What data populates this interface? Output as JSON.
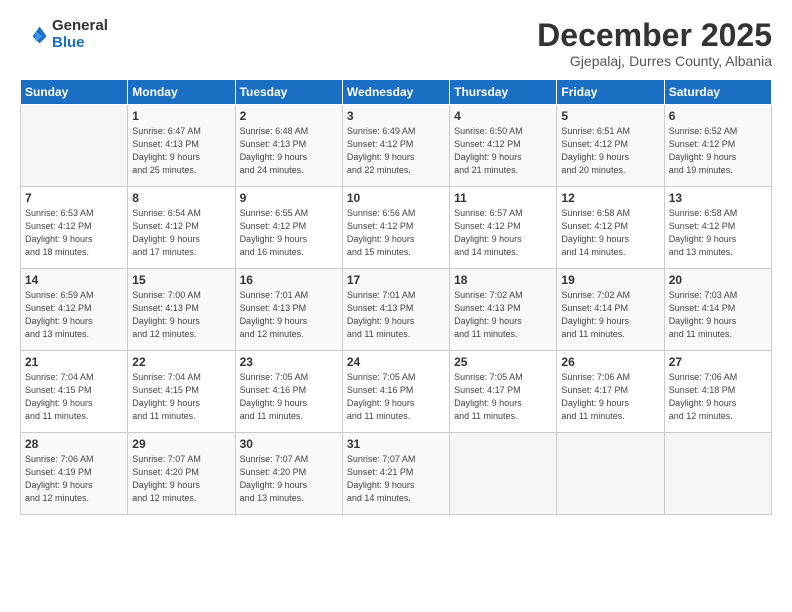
{
  "logo": {
    "general": "General",
    "blue": "Blue"
  },
  "header": {
    "month": "December 2025",
    "location": "Gjepalaj, Durres County, Albania"
  },
  "days_of_week": [
    "Sunday",
    "Monday",
    "Tuesday",
    "Wednesday",
    "Thursday",
    "Friday",
    "Saturday"
  ],
  "weeks": [
    [
      {
        "day": "",
        "info": ""
      },
      {
        "day": "1",
        "info": "Sunrise: 6:47 AM\nSunset: 4:13 PM\nDaylight: 9 hours\nand 25 minutes."
      },
      {
        "day": "2",
        "info": "Sunrise: 6:48 AM\nSunset: 4:13 PM\nDaylight: 9 hours\nand 24 minutes."
      },
      {
        "day": "3",
        "info": "Sunrise: 6:49 AM\nSunset: 4:12 PM\nDaylight: 9 hours\nand 22 minutes."
      },
      {
        "day": "4",
        "info": "Sunrise: 6:50 AM\nSunset: 4:12 PM\nDaylight: 9 hours\nand 21 minutes."
      },
      {
        "day": "5",
        "info": "Sunrise: 6:51 AM\nSunset: 4:12 PM\nDaylight: 9 hours\nand 20 minutes."
      },
      {
        "day": "6",
        "info": "Sunrise: 6:52 AM\nSunset: 4:12 PM\nDaylight: 9 hours\nand 19 minutes."
      }
    ],
    [
      {
        "day": "7",
        "info": "Sunrise: 6:53 AM\nSunset: 4:12 PM\nDaylight: 9 hours\nand 18 minutes."
      },
      {
        "day": "8",
        "info": "Sunrise: 6:54 AM\nSunset: 4:12 PM\nDaylight: 9 hours\nand 17 minutes."
      },
      {
        "day": "9",
        "info": "Sunrise: 6:55 AM\nSunset: 4:12 PM\nDaylight: 9 hours\nand 16 minutes."
      },
      {
        "day": "10",
        "info": "Sunrise: 6:56 AM\nSunset: 4:12 PM\nDaylight: 9 hours\nand 15 minutes."
      },
      {
        "day": "11",
        "info": "Sunrise: 6:57 AM\nSunset: 4:12 PM\nDaylight: 9 hours\nand 14 minutes."
      },
      {
        "day": "12",
        "info": "Sunrise: 6:58 AM\nSunset: 4:12 PM\nDaylight: 9 hours\nand 14 minutes."
      },
      {
        "day": "13",
        "info": "Sunrise: 6:58 AM\nSunset: 4:12 PM\nDaylight: 9 hours\nand 13 minutes."
      }
    ],
    [
      {
        "day": "14",
        "info": "Sunrise: 6:59 AM\nSunset: 4:12 PM\nDaylight: 9 hours\nand 13 minutes."
      },
      {
        "day": "15",
        "info": "Sunrise: 7:00 AM\nSunset: 4:13 PM\nDaylight: 9 hours\nand 12 minutes."
      },
      {
        "day": "16",
        "info": "Sunrise: 7:01 AM\nSunset: 4:13 PM\nDaylight: 9 hours\nand 12 minutes."
      },
      {
        "day": "17",
        "info": "Sunrise: 7:01 AM\nSunset: 4:13 PM\nDaylight: 9 hours\nand 11 minutes."
      },
      {
        "day": "18",
        "info": "Sunrise: 7:02 AM\nSunset: 4:13 PM\nDaylight: 9 hours\nand 11 minutes."
      },
      {
        "day": "19",
        "info": "Sunrise: 7:02 AM\nSunset: 4:14 PM\nDaylight: 9 hours\nand 11 minutes."
      },
      {
        "day": "20",
        "info": "Sunrise: 7:03 AM\nSunset: 4:14 PM\nDaylight: 9 hours\nand 11 minutes."
      }
    ],
    [
      {
        "day": "21",
        "info": "Sunrise: 7:04 AM\nSunset: 4:15 PM\nDaylight: 9 hours\nand 11 minutes."
      },
      {
        "day": "22",
        "info": "Sunrise: 7:04 AM\nSunset: 4:15 PM\nDaylight: 9 hours\nand 11 minutes."
      },
      {
        "day": "23",
        "info": "Sunrise: 7:05 AM\nSunset: 4:16 PM\nDaylight: 9 hours\nand 11 minutes."
      },
      {
        "day": "24",
        "info": "Sunrise: 7:05 AM\nSunset: 4:16 PM\nDaylight: 9 hours\nand 11 minutes."
      },
      {
        "day": "25",
        "info": "Sunrise: 7:05 AM\nSunset: 4:17 PM\nDaylight: 9 hours\nand 11 minutes."
      },
      {
        "day": "26",
        "info": "Sunrise: 7:06 AM\nSunset: 4:17 PM\nDaylight: 9 hours\nand 11 minutes."
      },
      {
        "day": "27",
        "info": "Sunrise: 7:06 AM\nSunset: 4:18 PM\nDaylight: 9 hours\nand 12 minutes."
      }
    ],
    [
      {
        "day": "28",
        "info": "Sunrise: 7:06 AM\nSunset: 4:19 PM\nDaylight: 9 hours\nand 12 minutes."
      },
      {
        "day": "29",
        "info": "Sunrise: 7:07 AM\nSunset: 4:20 PM\nDaylight: 9 hours\nand 12 minutes."
      },
      {
        "day": "30",
        "info": "Sunrise: 7:07 AM\nSunset: 4:20 PM\nDaylight: 9 hours\nand 13 minutes."
      },
      {
        "day": "31",
        "info": "Sunrise: 7:07 AM\nSunset: 4:21 PM\nDaylight: 9 hours\nand 14 minutes."
      },
      {
        "day": "",
        "info": ""
      },
      {
        "day": "",
        "info": ""
      },
      {
        "day": "",
        "info": ""
      }
    ]
  ]
}
